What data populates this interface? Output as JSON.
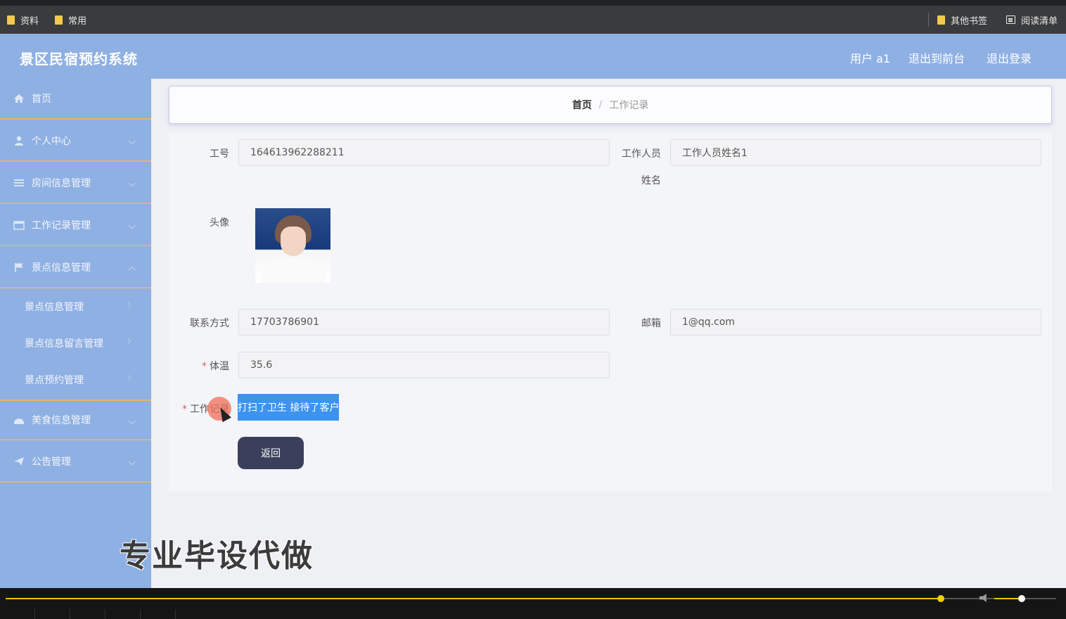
{
  "browser": {
    "bookmarks_left": [
      "资料",
      "常用"
    ],
    "bookmarks_right": [
      "其他书签",
      "阅读清单"
    ]
  },
  "header": {
    "title": "景区民宿预约系统",
    "user_label": "用户 a1",
    "front_label": "退出到前台",
    "logout_label": "退出登录"
  },
  "sidebar": {
    "items": [
      {
        "label": "首页",
        "icon": "home-icon"
      },
      {
        "label": "个人中心",
        "icon": "user-icon"
      },
      {
        "label": "房间信息管理",
        "icon": "list-icon"
      },
      {
        "label": "工作记录管理",
        "icon": "calendar-icon"
      },
      {
        "label": "景点信息管理",
        "icon": "flag-icon"
      }
    ],
    "sub_items": [
      "景点信息管理",
      "景点信息留言管理",
      "景点预约管理"
    ],
    "items_after": [
      {
        "label": "美食信息管理",
        "icon": "food-icon"
      },
      {
        "label": "公告管理",
        "icon": "send-icon"
      }
    ]
  },
  "breadcrumb": {
    "home": "首页",
    "separator": "/",
    "current": "工作记录"
  },
  "form": {
    "job_no_label": "工号",
    "job_no_value": "164613962288211",
    "staff_name_label_1": "工作人员",
    "staff_name_label_2": "姓名",
    "staff_name_value": "工作人员姓名1",
    "avatar_label": "头像",
    "contact_label": "联系方式",
    "contact_value": "17703786901",
    "email_label": "邮箱",
    "email_value": "1@qq.com",
    "temperature_label": "体温",
    "temperature_value": "35.6",
    "required_mark": "*",
    "work_record_label": "工作记录",
    "work_record_value": "打扫了卫生 接待了客户",
    "back_button": "返回"
  },
  "watermark": "专业毕设代做",
  "player": {
    "progress": 0.89,
    "volume": 0.44,
    "accent": "#e8c400"
  },
  "colors": {
    "sidebar": "#8fb0e3",
    "accent_border": "#e0b66f",
    "selection": "#3c93f0",
    "button": "#3a3f5c"
  }
}
